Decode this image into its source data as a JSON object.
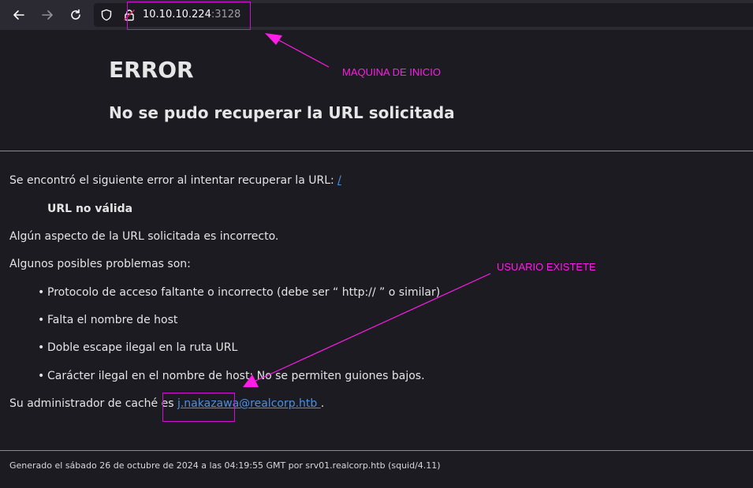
{
  "browser": {
    "url_host": "10.10.10.224",
    "url_port": ":3128",
    "icons": [
      "back-arrow-icon",
      "forward-arrow-icon",
      "reload-icon",
      "shield-icon",
      "lock-icon"
    ]
  },
  "header": {
    "title": "ERROR",
    "subtitle": "No se pudo recuperar la URL solicitada"
  },
  "body": {
    "intro": "Se encontró el siguiente error al intentar recuperar la URL:",
    "intro_link": "/",
    "error_name": "URL no válida",
    "description": "Algún aspecto de la URL solicitada es incorrecto.",
    "problems_heading": "Algunos posibles problemas son:",
    "problems": [
      "Protocolo de acceso faltante o incorrecto (debe ser “ http:// ” o similar)",
      "Falta el nombre de host",
      "Doble escape ilegal en la ruta URL",
      "Carácter ilegal en el nombre de host; No se permiten guiones bajos."
    ],
    "admin_prefix": "Su administrador de caché es",
    "admin_email": "j.nakazawa@realcorp.htb ",
    "admin_suffix": "."
  },
  "footer": {
    "text": "Generado el sábado 26 de octubre de 2024 a las 04:19:55 GMT por srv01.realcorp.htb (squid/4.11)"
  },
  "annotations": {
    "machine_label": "MAQUINA DE INICIO",
    "user_label": "USUARIO EXISTETE",
    "color": "#ff1ce8"
  },
  "colors": {
    "background": "#1c1b22",
    "toolbar": "#2b2a33",
    "link": "#4a90e2"
  }
}
